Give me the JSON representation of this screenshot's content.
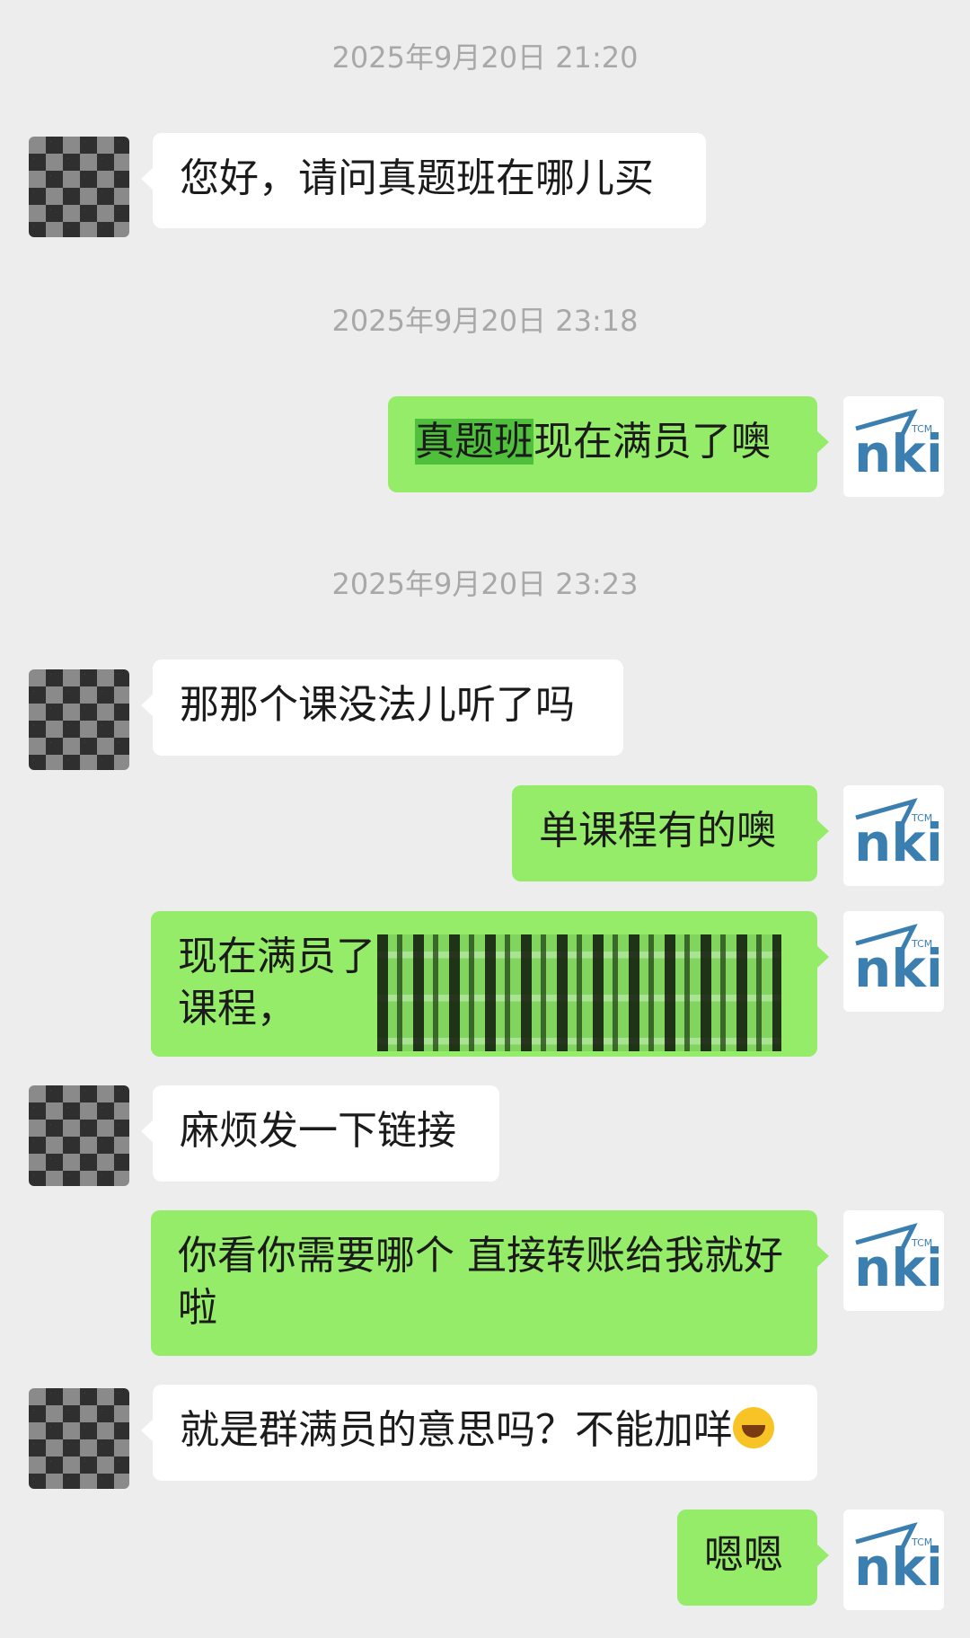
{
  "chat": {
    "messages": [
      {
        "type": "timestamp",
        "text": "2025年9月20日 21:20"
      },
      {
        "type": "in",
        "text": "您好，请问真题班在哪儿买"
      },
      {
        "type": "timestamp",
        "text": "2025年9月20日 23:18"
      },
      {
        "type": "out",
        "highlight": "真题班",
        "text": "现在满员了噢"
      },
      {
        "type": "timestamp",
        "text": "2025年9月20日 23:23"
      },
      {
        "type": "in",
        "text": "那那个课没法儿听了吗"
      },
      {
        "type": "out",
        "text": "单课程有的噢"
      },
      {
        "type": "out",
        "line1": "现在满员了",
        "line2": "课程，",
        "redacted": true
      },
      {
        "type": "in",
        "text": "麻烦发一下链接"
      },
      {
        "type": "out",
        "text": "你看你需要哪个 直接转账给我就好啦"
      },
      {
        "type": "in",
        "text": "就是群满员的意思吗？不能加咩",
        "emoji": "crying-face-emoji"
      },
      {
        "type": "out",
        "text": "嗯嗯"
      }
    ]
  },
  "avatars": {
    "user_alt": "pixelated avatar",
    "shop_logo_text": "nki",
    "shop_logo_small": "TCM"
  },
  "colors": {
    "background": "#ededed",
    "outgoing": "#95ec69",
    "incoming": "#ffffff",
    "timestamp": "#a8a8a8",
    "logo": "#3a7fb0"
  }
}
